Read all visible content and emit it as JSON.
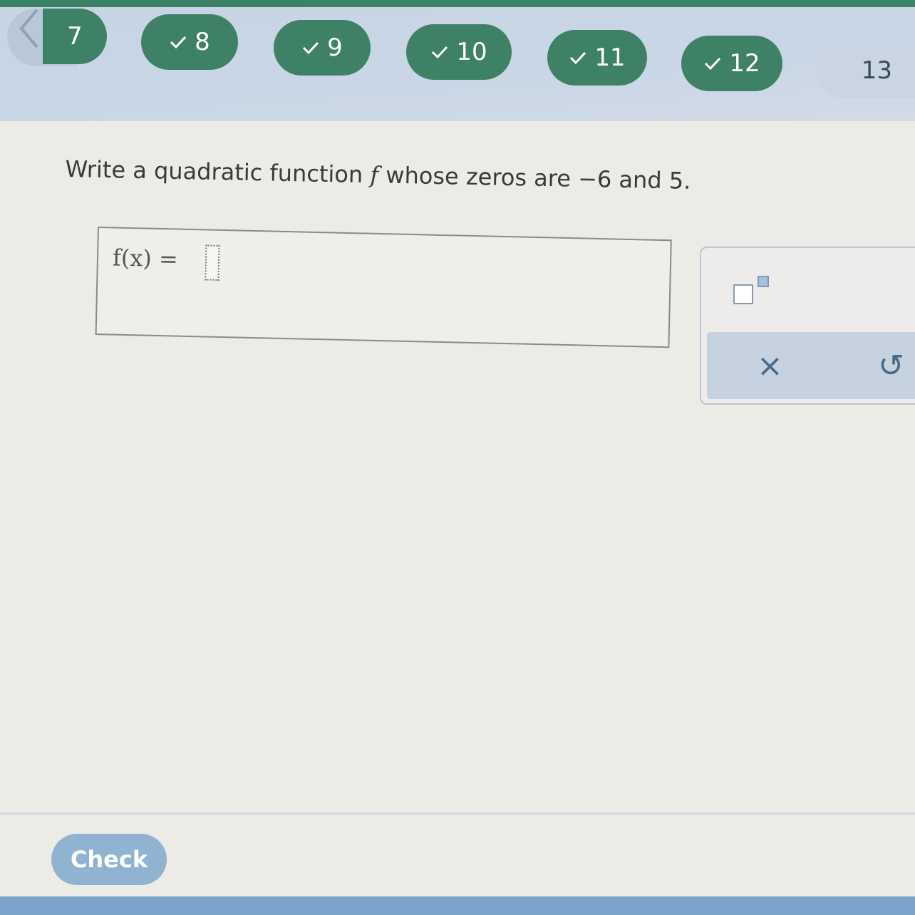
{
  "nav": {
    "items": [
      {
        "label": "7",
        "checked": false,
        "current": false
      },
      {
        "label": "8",
        "checked": true,
        "current": false
      },
      {
        "label": "9",
        "checked": true,
        "current": false
      },
      {
        "label": "10",
        "checked": true,
        "current": false
      },
      {
        "label": "11",
        "checked": true,
        "current": false
      },
      {
        "label": "12",
        "checked": true,
        "current": false
      },
      {
        "label": "13",
        "checked": false,
        "current": true
      }
    ],
    "back_icon": "chevron-left-icon",
    "check_icon": "checkmark-icon"
  },
  "question": {
    "prefix": "Write a quadratic function ",
    "function_name": "f",
    "suffix": " whose zeros are −6 and 5."
  },
  "answer": {
    "lhs": "f(x) =",
    "value": ""
  },
  "keypad": {
    "superscript_icon": "superscript-template-icon",
    "clear_label": "×",
    "undo_label": "↺"
  },
  "footer": {
    "check_label": "Check"
  },
  "colors": {
    "nav_done": "#3f8166",
    "nav_current": "#c9d5e3",
    "check_button": "#8fb3d0",
    "background": "#ecebe6"
  }
}
